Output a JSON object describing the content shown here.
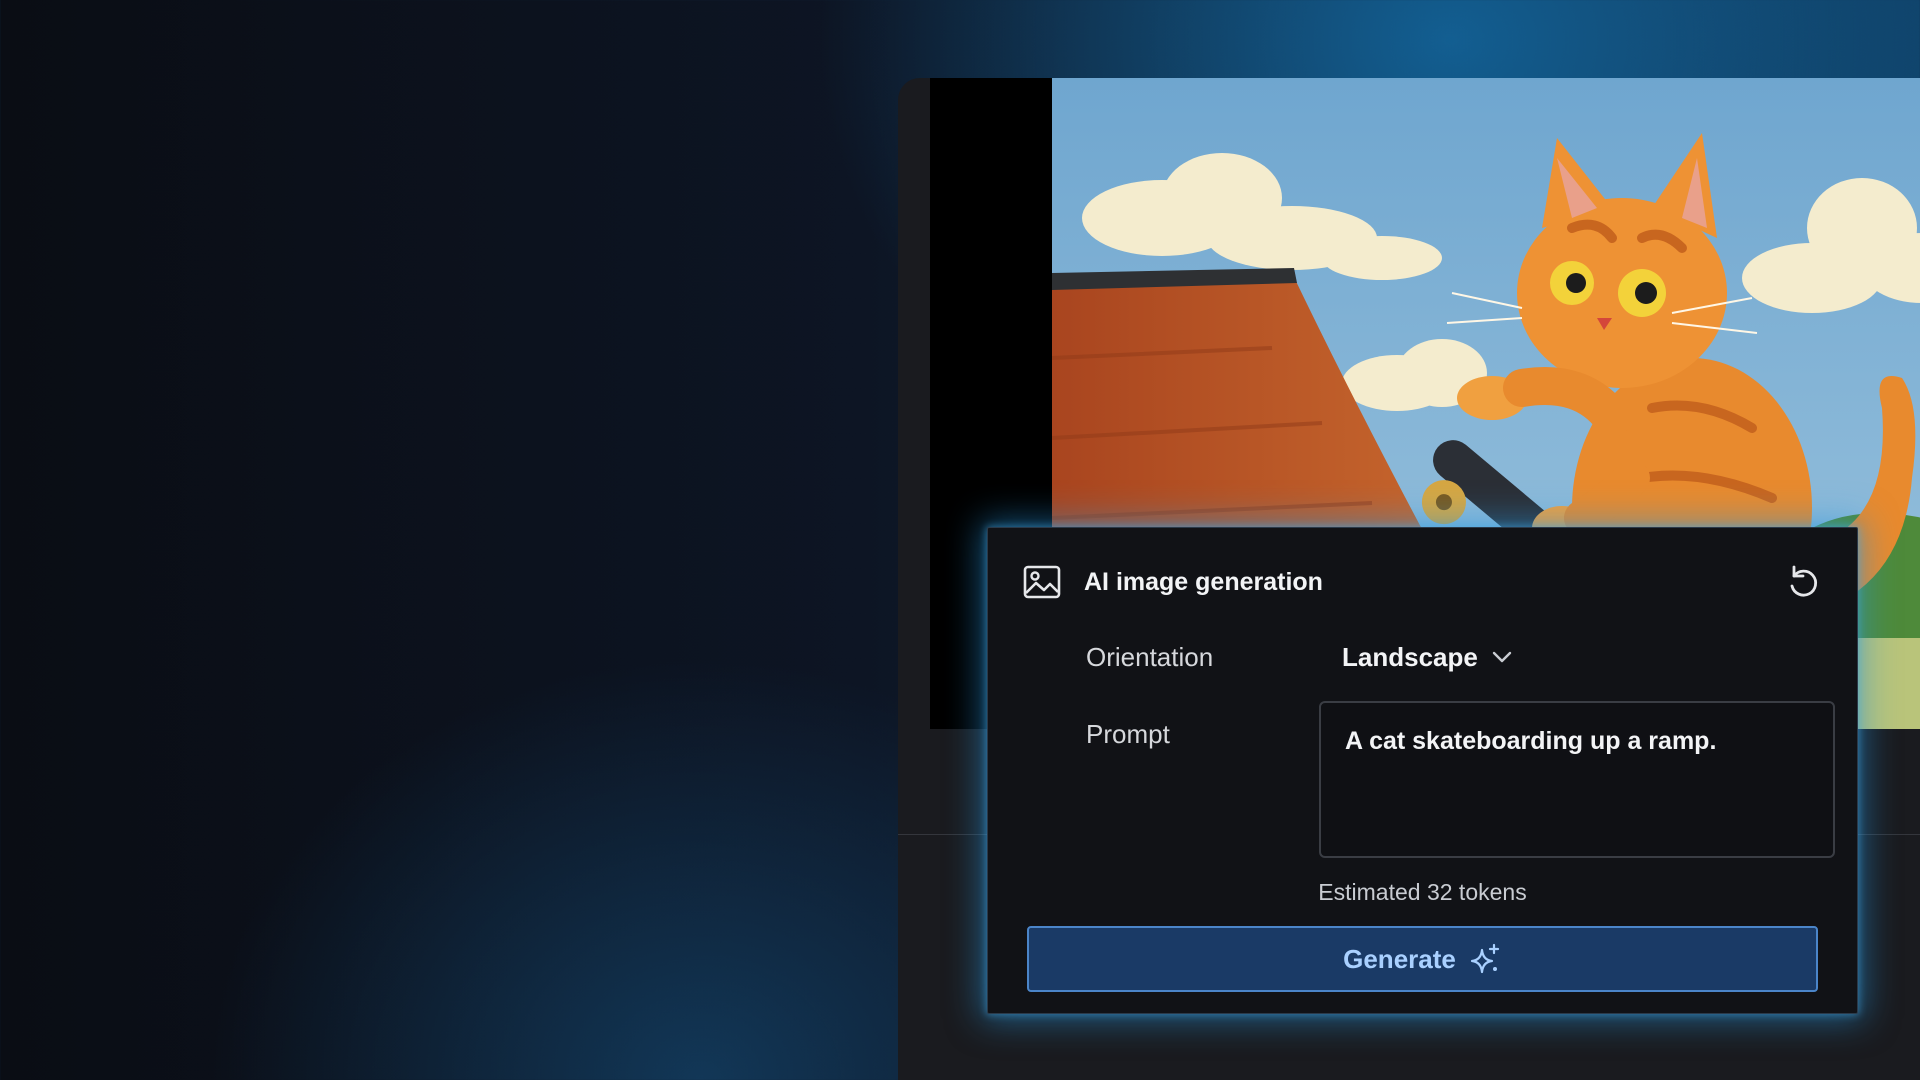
{
  "panel": {
    "title": "AI image generation",
    "icons": {
      "header": "image-icon",
      "reset": "reset-icon",
      "dropdown": "chevron-down-icon",
      "generate": "sparkle-icon"
    }
  },
  "orientation": {
    "label": "Orientation",
    "selected": "Landscape"
  },
  "prompt": {
    "label": "Prompt",
    "value": "A cat skateboarding up a ramp."
  },
  "token_estimate": "Estimated 32 tokens",
  "generate": {
    "label": "Generate"
  },
  "colors": {
    "accent": "#4b85c9",
    "button_bg": "#1a3a66",
    "button_text": "#a9d0ff",
    "glow": "#2696dc",
    "panel_bg": "#111216"
  }
}
